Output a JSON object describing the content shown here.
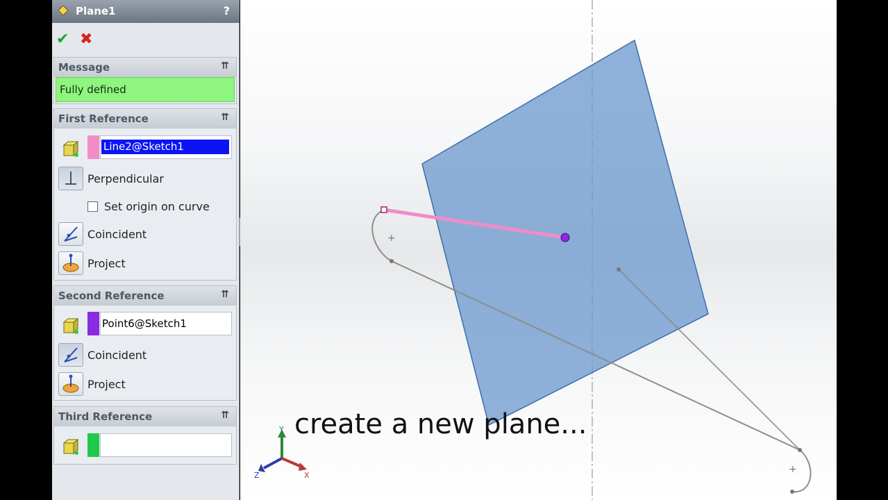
{
  "window": {
    "title": "Plane1",
    "help": "?"
  },
  "actions": {
    "ok": "✔",
    "cancel": "✖"
  },
  "message": {
    "header": "Message",
    "text": "Fully defined",
    "collapse": "⇈"
  },
  "first_reference": {
    "header": "First Reference",
    "collapse": "⇈",
    "selection": "Line2@Sketch1",
    "swatch_color": "#f08cc8",
    "options": {
      "perpendicular": "Perpendicular",
      "set_origin": "Set origin on curve",
      "coincident": "Coincident",
      "project": "Project"
    }
  },
  "second_reference": {
    "header": "Second Reference",
    "collapse": "⇈",
    "selection": "Point6@Sketch1",
    "swatch_color": "#8a2be2",
    "options": {
      "coincident": "Coincident",
      "project": "Project"
    }
  },
  "third_reference": {
    "header": "Third Reference",
    "collapse": "⇈",
    "selection": "",
    "swatch_color": "#22c84a"
  },
  "viewport": {
    "caption": "create a new plane...",
    "triad": {
      "x": "X",
      "y": "Y",
      "z": "Z"
    },
    "plane_color": "#6f9bcf",
    "line_color": "#f08cc8",
    "point_color": "#8a2be2"
  }
}
